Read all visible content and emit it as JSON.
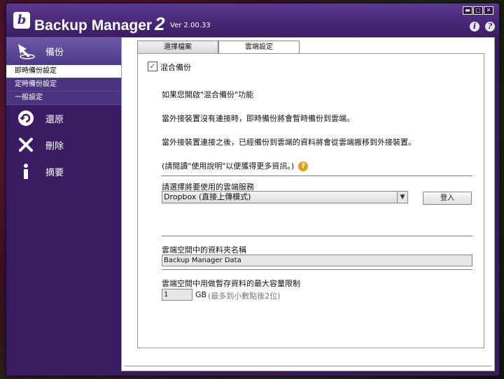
{
  "window": {
    "title": "Backup Manager",
    "title_num": "2",
    "version": "Ver 2.00.33",
    "controls": {
      "min": "▬",
      "max": "▢",
      "close": "✕"
    },
    "info_icon": "info-icon",
    "help_icon": "help-icon",
    "info_glyph": "i",
    "help_glyph": "?"
  },
  "sidebar": {
    "backup_label": "備份",
    "sub_items": [
      "即時備份設定",
      "定時備份設定",
      "一般設定"
    ],
    "restore_label": "還原",
    "delete_label": "刪除",
    "summary_label": "摘要",
    "active_sub_index": 0
  },
  "tabs": [
    "選擇檔案",
    "雲端設定"
  ],
  "active_tab": 1,
  "panel": {
    "hybrid_checked": true,
    "hybrid_label": "混合備份",
    "para1": "如果您開啟\"混合備份\"功能",
    "para2": "當外接裝置沒有連接時，即時備份將會暫時備份到雲端。",
    "para3": "當外接裝置連接之後，已經備份到雲端的資料將會從雲端搬移到外接裝置。",
    "para4": "(請閱讀\"使用說明\"以便獲得更多資訊。)",
    "service_label": "請選擇將要使用的雲端服務",
    "service_value": "Dropbox (直接上傳模式)",
    "login_label": "登入",
    "folder_label": "雲端空間中的資料夾名稱",
    "folder_value": "Backup Manager Data",
    "capacity_label": "雲端空間中用做暫存資料的最大容量限制",
    "capacity_value": "1",
    "capacity_unit": "GB",
    "capacity_hint": "(最多到小數點後2位)"
  },
  "colors": {
    "sidebar_bg": "#3a1c63",
    "accent": "#6c5aa8",
    "help_badge": "#e0a020"
  }
}
